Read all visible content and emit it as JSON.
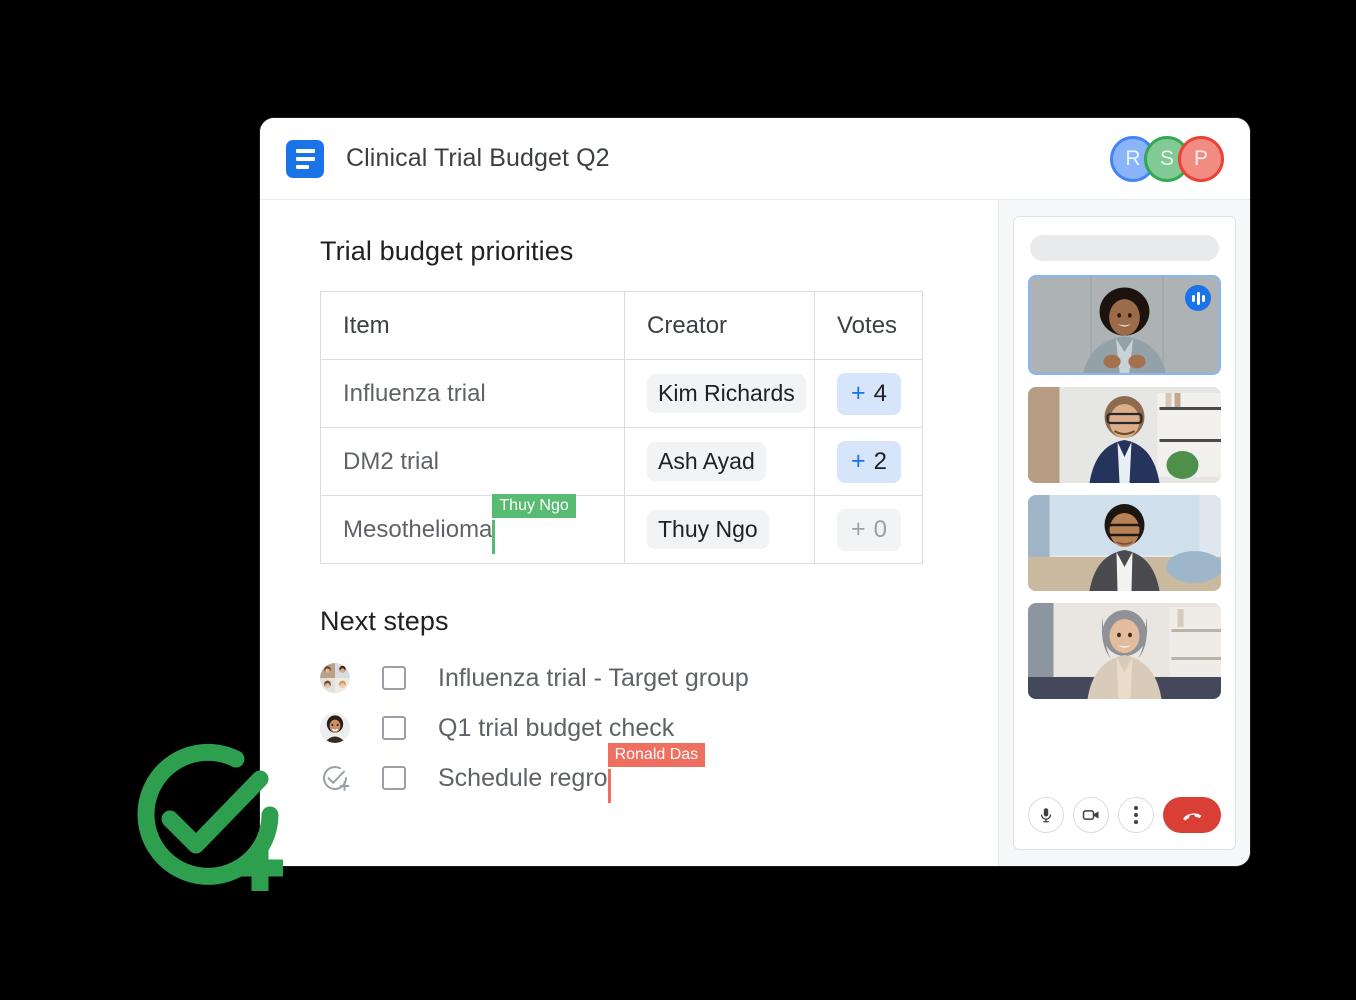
{
  "window": {
    "header": {
      "doc_icon": "docs-icon",
      "title": "Clinical Trial Budget Q2",
      "avatars": [
        {
          "initial": "R",
          "color": "#8ab4f8",
          "ring": "#4285f4"
        },
        {
          "initial": "S",
          "color": "#81c995",
          "ring": "#34a853"
        },
        {
          "initial": "P",
          "color": "#f28b82",
          "ring": "#ea4335"
        }
      ]
    },
    "document": {
      "priorities_heading": "Trial budget priorities",
      "table": {
        "columns": [
          "Item",
          "Creator",
          "Votes"
        ],
        "rows": [
          {
            "item": "Influenza trial",
            "creator": "Kim Richards",
            "vote_plus": "+",
            "vote_count": "4",
            "vote_state": "active"
          },
          {
            "item": "DM2 trial",
            "creator": "Ash Ayad",
            "vote_plus": "+",
            "vote_count": "2",
            "vote_state": "active"
          },
          {
            "item": "Mesothelioma",
            "creator": "Thuy Ngo",
            "vote_plus": "+",
            "vote_count": "0",
            "vote_state": "zero"
          }
        ]
      },
      "cursors": [
        {
          "name": "Thuy Ngo",
          "color": "#57bb72",
          "anchor": "table-item-mesothelioma"
        },
        {
          "name": "Ronald Das",
          "color": "#ef6f61",
          "anchor": "next-step-schedule-regro"
        }
      ],
      "next_steps_heading": "Next steps",
      "next_steps": [
        {
          "label": "Influenza trial - Target group",
          "avatar": "group-avatar-stack",
          "checked": false
        },
        {
          "label": "Q1 trial budget check",
          "avatar": "single-avatar",
          "checked": false
        },
        {
          "label": "Schedule regro",
          "avatar": "assign-task-icon",
          "checked": false
        }
      ]
    },
    "meet_panel": {
      "search_placeholder_bar": "search-placeholder",
      "tiles": [
        {
          "name": "participant-tile-1",
          "speaking": true,
          "badge": "audio-wave-icon"
        },
        {
          "name": "participant-tile-2",
          "speaking": false,
          "badge": ""
        },
        {
          "name": "participant-tile-3",
          "speaking": false,
          "badge": ""
        },
        {
          "name": "participant-tile-4",
          "speaking": false,
          "badge": ""
        }
      ],
      "controls": [
        {
          "name": "microphone-button",
          "icon": "microphone-icon"
        },
        {
          "name": "camera-button",
          "icon": "video-camera-icon"
        },
        {
          "name": "more-options-button",
          "icon": "three-dots-icon"
        },
        {
          "name": "end-call-button",
          "icon": "phone-hangup-icon",
          "color": "#d93f34"
        }
      ]
    }
  },
  "overlay": {
    "badge": {
      "name": "assign-task-badge",
      "color": "#2e9e4f"
    }
  }
}
